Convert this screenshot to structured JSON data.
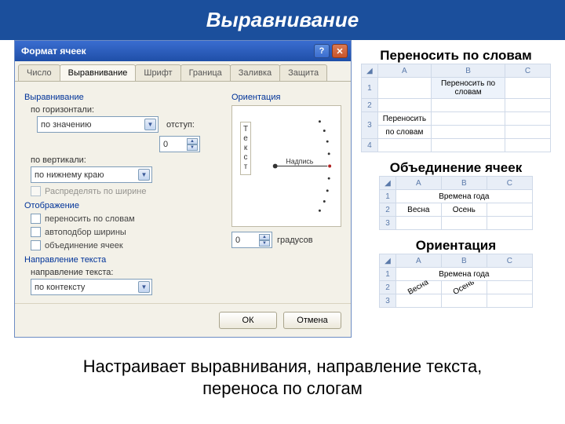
{
  "page": {
    "title": "Выравнивание",
    "footer_line1": "Настраивает выравнивания, направление текста,",
    "footer_line2": "переноса по слогам"
  },
  "dialog": {
    "title": "Формат ячеек",
    "tabs": [
      "Число",
      "Выравнивание",
      "Шрифт",
      "Граница",
      "Заливка",
      "Защита"
    ],
    "sections": {
      "alignment": "Выравнивание",
      "display": "Отображение",
      "direction": "Направление текста",
      "orientation": "Ориентация"
    },
    "labels": {
      "horiz": "по горизонтали:",
      "vert": "по вертикали:",
      "indent": "отступ:",
      "dir": "направление текста:",
      "degrees": "градусов",
      "vtext": "Т\nе\nк\nс\nт",
      "nadpis": "Надпись"
    },
    "values": {
      "horiz": "по значению",
      "vert": "по нижнему краю",
      "indent": "0",
      "dir": "по контексту",
      "degrees": "0"
    },
    "checks": {
      "distribute": "Распределять по ширине",
      "wrap": "переносить по словам",
      "autofit": "автоподбор ширины",
      "merge": "объединение ячеек"
    },
    "buttons": {
      "ok": "ОК",
      "cancel": "Отмена"
    }
  },
  "examples": {
    "wrap": {
      "title": "Переносить по словам",
      "cols": [
        "A",
        "B",
        "C"
      ],
      "r1_b": "Переносить по словам",
      "r3_a1": "Переносить",
      "r3_a2": "по словам"
    },
    "merge": {
      "title": "Объединение ячеек",
      "cols": [
        "A",
        "B",
        "C"
      ],
      "r1_merged": "Времена года",
      "r2_a": "Весна",
      "r2_b": "Осень"
    },
    "orient": {
      "title": "Ориентация",
      "cols": [
        "A",
        "B",
        "C"
      ],
      "r1_merged": "Времена года",
      "r2_a": "Весна",
      "r2_b": "Осень"
    }
  }
}
